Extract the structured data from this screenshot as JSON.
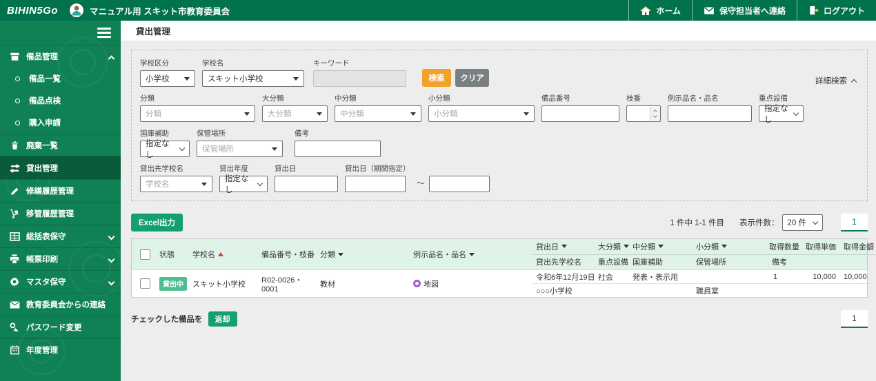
{
  "header": {
    "logo": "BIHIN5Go",
    "org_name": "マニュアル用 スキット市教育委員会",
    "nav": {
      "home": "ホーム",
      "contact": "保守担当者へ連絡",
      "logout": "ログアウト"
    }
  },
  "page": {
    "title": "貸出管理"
  },
  "sidebar": {
    "items": [
      {
        "label": "備品管理",
        "icon": "archive-icon",
        "state": "expanded"
      },
      {
        "label": "備品一覧",
        "icon": "circle-bullet"
      },
      {
        "label": "備品点検",
        "icon": "circle-bullet"
      },
      {
        "label": "購入申請",
        "icon": "circle-bullet"
      },
      {
        "label": "廃棄一覧",
        "icon": "trash-icon"
      },
      {
        "label": "貸出管理",
        "icon": "swap-icon",
        "state": "active"
      },
      {
        "label": "修繕履歴管理",
        "icon": "pencil-icon"
      },
      {
        "label": "移管履歴管理",
        "icon": "dolly-icon"
      },
      {
        "label": "総括表保守",
        "icon": "table-icon",
        "state": "collapsed"
      },
      {
        "label": "帳票印刷",
        "icon": "printer-icon",
        "state": "collapsed"
      },
      {
        "label": "マスタ保守",
        "icon": "gear-icon",
        "state": "collapsed"
      },
      {
        "label": "教育委員会からの連絡",
        "icon": "mail-icon"
      },
      {
        "label": "パスワード変更",
        "icon": "key-icon"
      },
      {
        "label": "年度管理",
        "icon": "calendar-icon"
      }
    ]
  },
  "search": {
    "school_type": {
      "label": "学校区分",
      "value": "小学校"
    },
    "school_name": {
      "label": "学校名",
      "value": "スキット小学校"
    },
    "keyword": {
      "label": "キーワード",
      "value": ""
    },
    "search_button": "検索",
    "clear_button": "クリア",
    "detail_toggle": "詳細検索",
    "category": {
      "label": "分類",
      "placeholder": "分類"
    },
    "major": {
      "label": "大分類",
      "placeholder": "大分類"
    },
    "middle": {
      "label": "中分類",
      "placeholder": "中分類"
    },
    "minor": {
      "label": "小分類",
      "placeholder": "小分類"
    },
    "item_no": {
      "label": "備品番号",
      "value": ""
    },
    "branch_no": {
      "label": "枝番",
      "value": ""
    },
    "item_name": {
      "label": "例示品名・品名",
      "value": ""
    },
    "priority": {
      "label": "重点設備",
      "value": "指定なし"
    },
    "subsidy": {
      "label": "国庫補助",
      "value": "指定なし"
    },
    "location": {
      "label": "保管場所",
      "placeholder": "保管場所"
    },
    "note": {
      "label": "備考",
      "value": ""
    },
    "borrower": {
      "label": "貸出先学校名",
      "placeholder": "学校名"
    },
    "loan_year": {
      "label": "貸出年度",
      "value": "指定なし"
    },
    "loan_date": {
      "label": "貸出日",
      "value": ""
    },
    "loan_period": {
      "label": "貸出日（期間指定）",
      "from": "",
      "separator": "～",
      "to": ""
    }
  },
  "toolbar": {
    "excel_button": "Excel出力",
    "result_count": "1 件中 1-1 件目",
    "page_size_label": "表示件数：",
    "page_size_value": "20 件",
    "page_number": "1"
  },
  "table": {
    "headers": {
      "status": "状態",
      "school": "学校名",
      "item_no": "備品番号・枝番",
      "category": "分類",
      "name": "例示品名・品名",
      "loan_date": "貸出日",
      "major": "大分類",
      "middle": "中分類",
      "minor": "小分類",
      "qty": "取得数量",
      "unit_price": "取得単価",
      "amount": "取得金額",
      "borrower": "貸出先学校名",
      "priority": "重点設備",
      "subsidy": "国庫補助",
      "location": "保管場所",
      "note": "備考"
    },
    "rows": [
      {
        "status": "貸出中",
        "school": "スキット小学校",
        "item_no": "R02-0026・0001",
        "category": "教材",
        "name": "地図",
        "loan_date": "令和6年12月19日",
        "major": "社会",
        "middle": "発表・表示用",
        "minor": "",
        "qty": "1",
        "unit_price": "10,000",
        "amount": "10,000",
        "borrower": "○○○小学校",
        "priority": "",
        "subsidy": "",
        "location": "職員室",
        "note": ""
      }
    ]
  },
  "footer": {
    "check_label": "チェックした備品を",
    "return_button": "返却",
    "page_number": "1"
  },
  "colors": {
    "topbar_green": "#00724C",
    "sidebar_green": "#0F8154",
    "sidebar_active_green": "#0A5B3B",
    "accent_green": "#17A06F",
    "search_orange": "#F2A22C",
    "clear_gray": "#7A7F82",
    "table_header_mint": "#DFF3E9",
    "badge_green": "#4FBE8F",
    "info_purple": "#A35BC6",
    "sort_red": "#E03C31"
  }
}
